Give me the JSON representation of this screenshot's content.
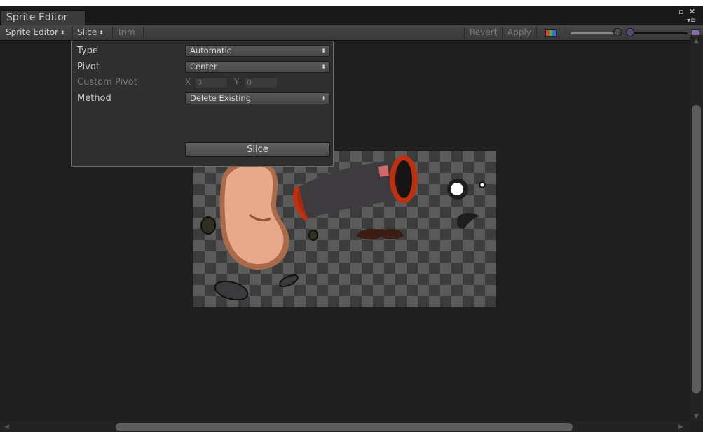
{
  "window": {
    "tab_title": "Sprite Editor",
    "controls": {
      "maximize_glyph": "▫",
      "close_glyph": "✕",
      "menu_glyph": "▾≡"
    }
  },
  "toolbar": {
    "sprite_editor_dropdown": "Sprite Editor",
    "slice_dropdown": "Slice",
    "trim_label": "Trim",
    "revert_label": "Revert",
    "apply_label": "Apply",
    "updown_glyph": "⬍",
    "zoom_level": 0.95,
    "mip_level": 0.0
  },
  "slice_panel": {
    "type_label": "Type",
    "type_value": "Automatic",
    "pivot_label": "Pivot",
    "pivot_value": "Center",
    "custom_pivot_label": "Custom Pivot",
    "x_label": "X",
    "x_value": "0",
    "y_label": "Y",
    "y_value": "0",
    "method_label": "Method",
    "method_value": "Delete Existing",
    "slice_button": "Slice"
  },
  "colors": {
    "window_bg": "#1f1f1f",
    "panel_bg": "#2f2f2f",
    "checker_light": "#5a5a5a",
    "checker_dark": "#3c3c3c",
    "bean_skin": "#e8a98a",
    "can_body": "#3d3b3e",
    "can_rim": "#c0300e",
    "mustache": "#3a1e14"
  }
}
